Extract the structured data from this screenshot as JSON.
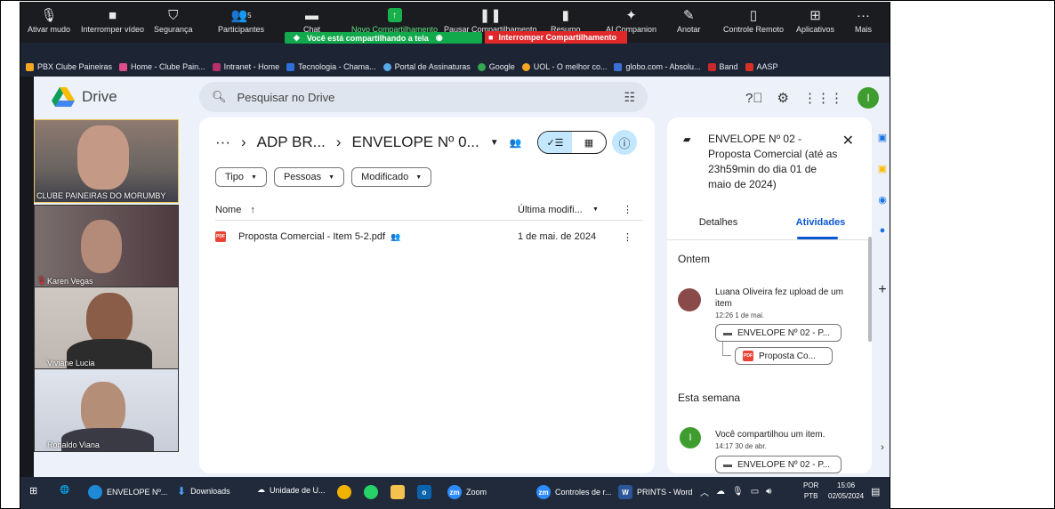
{
  "zoom_toolbar": {
    "items": [
      {
        "label": "Ativar mudo"
      },
      {
        "label": "Interromper vídeo"
      },
      {
        "label": "Segurança"
      },
      {
        "label": "Participantes",
        "count": "5"
      },
      {
        "label": "Chat"
      },
      {
        "label": "Novo Compartilhamento"
      },
      {
        "label": "Pausar Compartilhamento"
      },
      {
        "label": "Resumo"
      },
      {
        "label": "AI Companion"
      },
      {
        "label": "Anotar"
      },
      {
        "label": "Controle Remoto"
      },
      {
        "label": "Aplicativos"
      },
      {
        "label": "Mais"
      }
    ],
    "share_banner": "Você está compartilhando a tela",
    "stop_banner": "Interromper Compartilhamento"
  },
  "browser": {
    "url": "https://drive.google.com/drive/folders/...",
    "bookmarks": [
      "PBX Clube Paineiras",
      "Home - Clube Pain...",
      "Intranet - Home",
      "Tecnologia - Chama...",
      "Portal de Assinaturas",
      "Google",
      "UOL - O melhor co...",
      "globo.com - Absolu...",
      "Band",
      "AASP"
    ]
  },
  "drive": {
    "app_name": "Drive",
    "search_placeholder": "Pesquisar no Drive",
    "avatar_letter": "I",
    "breadcrumb": {
      "ellipsis": "···",
      "parent": "ADP BR...",
      "current": "ENVELOPE Nº 0..."
    },
    "filters": [
      "Tipo",
      "Pessoas",
      "Modificado"
    ],
    "columns": {
      "name": "Nome",
      "modified": "Última modifi..."
    },
    "files": [
      {
        "name": "Proposta Comercial - Item 5-2.pdf",
        "modified": "1 de mai. de 2024"
      }
    ],
    "details": {
      "title": "ENVELOPE Nº 02 - Proposta Comercial (até as 23h59min do dia 01 de maio de 2024)",
      "tabs": [
        "Detalhes",
        "Atividades"
      ],
      "sections": [
        {
          "heading": "Ontem",
          "text": "Luana Oliveira fez upload de um item",
          "time": "12:26 1 de mai.",
          "folder": "ENVELOPE Nº 02 - P...",
          "file": "Proposta Co..."
        },
        {
          "heading": "Esta semana",
          "text": "Você compartilhou um item.",
          "time": "14:17 30 de abr.",
          "folder": "ENVELOPE Nº 02 - P...",
          "avatar_letter": "I"
        }
      ]
    }
  },
  "participants": [
    {
      "name": "CLUBE PAINEIRAS DO MORUMBY"
    },
    {
      "name": "Karen Vegas"
    },
    {
      "name": "Viviane Lucia"
    },
    {
      "name": "Ronaldo Viana"
    }
  ],
  "taskbar": {
    "items": [
      "ENVELOPE Nº...",
      "Downloads",
      "Unidade de U...",
      "Zoom",
      "Controles de r...",
      "PRINTS - Word"
    ],
    "lang": "POR",
    "layout": "PTB",
    "time": "15:06",
    "date": "02/05/2024"
  },
  "colors": {
    "zoom_green": "#12a84c",
    "stop_red": "#e0272a",
    "drive_blue": "#0b57d0",
    "taskbar": "#202a3a"
  }
}
